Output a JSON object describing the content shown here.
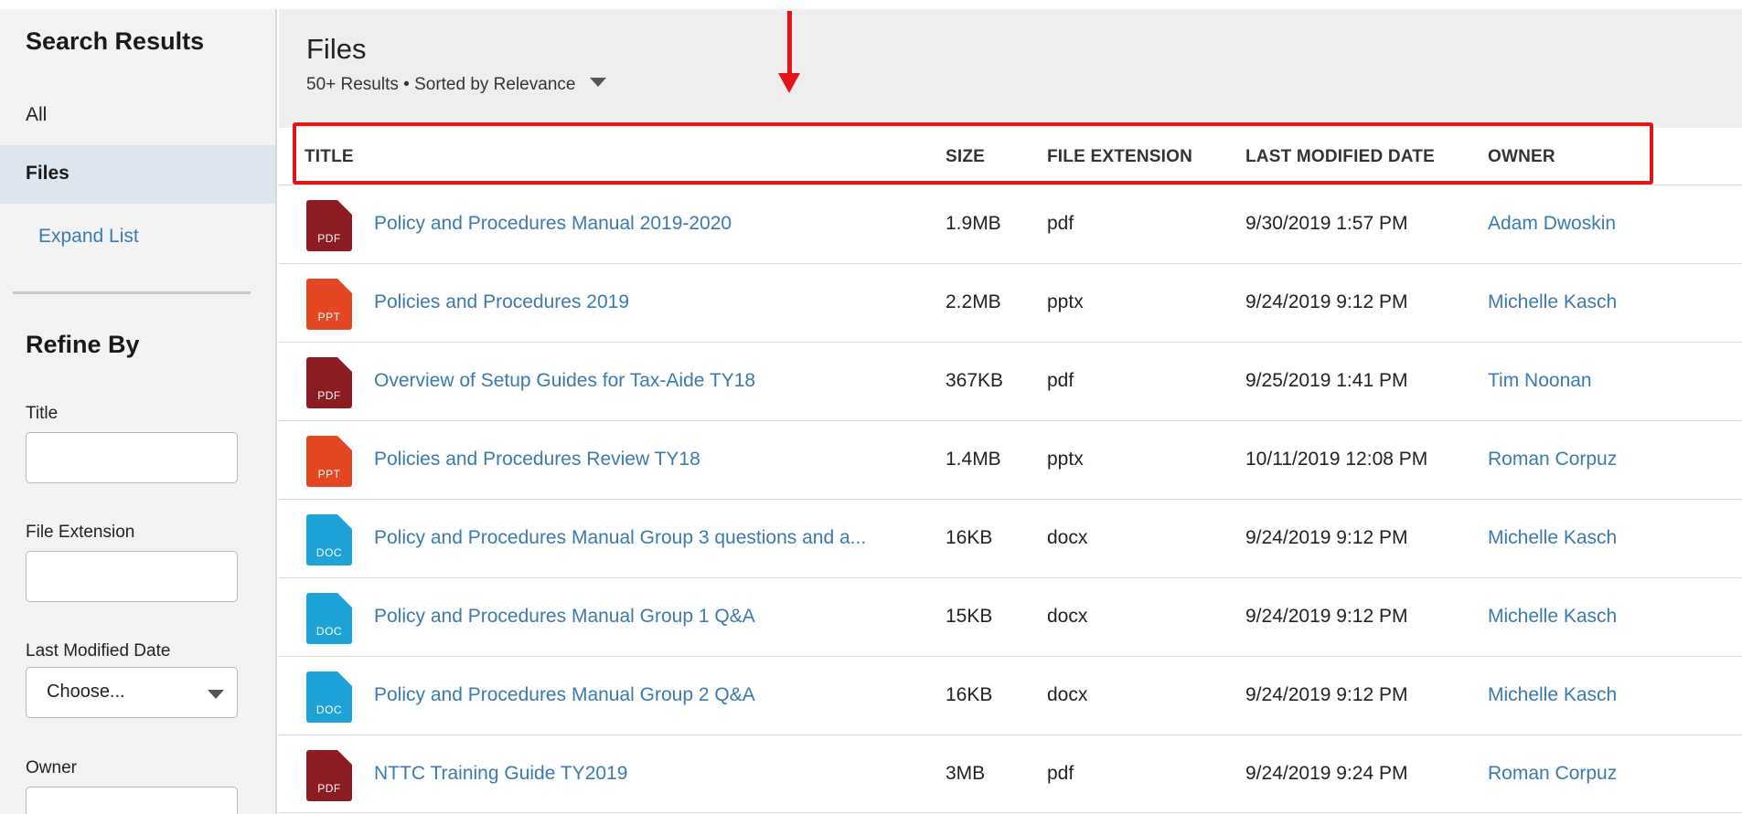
{
  "sidebar": {
    "heading": "Search Results",
    "all_label": "All",
    "files_label": "Files",
    "expand_label": "Expand List",
    "refine_heading": "Refine By",
    "filters": {
      "title_label": "Title",
      "title_value": "",
      "extension_label": "File Extension",
      "extension_value": "",
      "date_label": "Last Modified Date",
      "date_value": "Choose...",
      "owner_label": "Owner",
      "owner_value": ""
    }
  },
  "main": {
    "title": "Files",
    "subtitle": "50+ Results • Sorted by Relevance"
  },
  "table": {
    "headers": {
      "title": "TITLE",
      "size": "SIZE",
      "ext": "FILE EXTENSION",
      "date": "LAST MODIFIED DATE",
      "owner": "OWNER"
    },
    "rows": [
      {
        "icon": "pdf-file-icon",
        "tag": "PDF",
        "color": "#8d1c22",
        "title": "Policy and Procedures Manual 2019-2020",
        "size": "1.9MB",
        "ext": "pdf",
        "date": "9/30/2019 1:57 PM",
        "owner": "Adam Dwoskin"
      },
      {
        "icon": "ppt-file-icon",
        "tag": "PPT",
        "color": "#e34724",
        "title": "Policies and Procedures 2019",
        "size": "2.2MB",
        "ext": "pptx",
        "date": "9/24/2019 9:12 PM",
        "owner": "Michelle Kasch"
      },
      {
        "icon": "pdf-file-icon",
        "tag": "PDF",
        "color": "#8d1c22",
        "title": "Overview of Setup Guides for Tax-Aide TY18",
        "size": "367KB",
        "ext": "pdf",
        "date": "9/25/2019 1:41 PM",
        "owner": "Tim Noonan"
      },
      {
        "icon": "ppt-file-icon",
        "tag": "PPT",
        "color": "#e34724",
        "title": "Policies and Procedures Review TY18",
        "size": "1.4MB",
        "ext": "pptx",
        "date": "10/11/2019 12:08 PM",
        "owner": "Roman Corpuz"
      },
      {
        "icon": "doc-file-icon",
        "tag": "DOC",
        "color": "#1ea3d9",
        "title": "Policy and Procedures Manual Group 3 questions and a...",
        "size": "16KB",
        "ext": "docx",
        "date": "9/24/2019 9:12 PM",
        "owner": "Michelle Kasch"
      },
      {
        "icon": "doc-file-icon",
        "tag": "DOC",
        "color": "#1ea3d9",
        "title": "Policy and Procedures Manual Group 1 Q&A",
        "size": "15KB",
        "ext": "docx",
        "date": "9/24/2019 9:12 PM",
        "owner": "Michelle Kasch"
      },
      {
        "icon": "doc-file-icon",
        "tag": "DOC",
        "color": "#1ea3d9",
        "title": "Policy and Procedures Manual Group 2 Q&A",
        "size": "16KB",
        "ext": "docx",
        "date": "9/24/2019 9:12 PM",
        "owner": "Michelle Kasch"
      },
      {
        "icon": "pdf-file-icon",
        "tag": "PDF",
        "color": "#8d1c22",
        "title": "NTTC Training Guide TY2019",
        "size": "3MB",
        "ext": "pdf",
        "date": "9/24/2019 9:24 PM",
        "owner": "Roman Corpuz"
      }
    ]
  },
  "annotation": {
    "color": "#e4141b",
    "arrow_icon": "down-arrow-icon"
  }
}
